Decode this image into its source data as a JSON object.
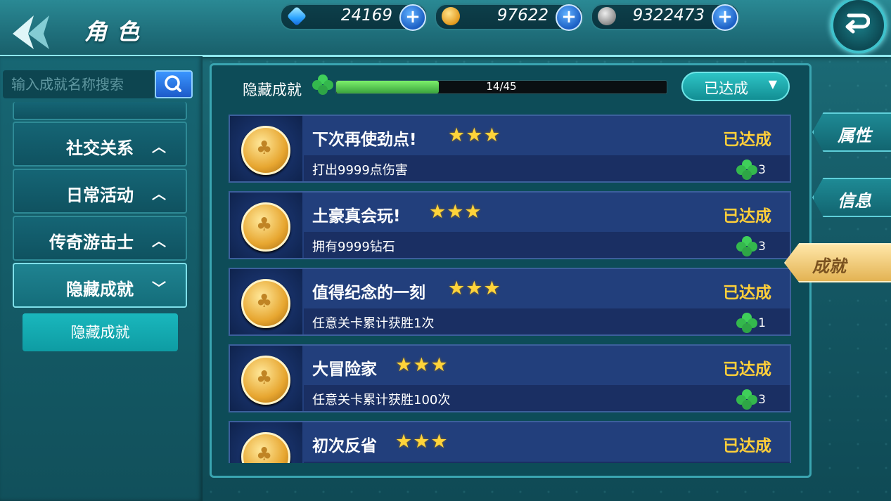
{
  "header": {
    "title": "角色"
  },
  "resources": [
    {
      "name": "gem",
      "value": "24169"
    },
    {
      "name": "gold",
      "value": "97622"
    },
    {
      "name": "silver",
      "value": "9322473"
    }
  ],
  "sidebar": {
    "search_placeholder": "输入成就名称搜索",
    "items": [
      {
        "label": "社交关系"
      },
      {
        "label": "日常活动"
      },
      {
        "label": "传奇游击士"
      },
      {
        "label": "隐藏成就"
      }
    ],
    "sub_button": "隐藏成就"
  },
  "panel": {
    "category_label": "隐藏成就",
    "progress_text": "14/45",
    "progress_fraction": 0.3111,
    "filter_label": "已达成"
  },
  "achievements": [
    {
      "name": "下次再使劲点!",
      "desc": "打出9999点伤害",
      "status": "已达成",
      "reward": "3",
      "stars": 3
    },
    {
      "name": "土豪真会玩!",
      "desc": "拥有9999钻石",
      "status": "已达成",
      "reward": "3",
      "stars": 3
    },
    {
      "name": "值得纪念的一刻",
      "desc": "任意关卡累计获胜1次",
      "status": "已达成",
      "reward": "1",
      "stars": 3
    },
    {
      "name": "大冒险家",
      "desc": "任意关卡累计获胜100次",
      "status": "已达成",
      "reward": "3",
      "stars": 3
    },
    {
      "name": "初次反省",
      "desc": "",
      "status": "已达成",
      "reward": "",
      "stars": 3
    }
  ],
  "right_tabs": [
    {
      "label": "属性"
    },
    {
      "label": "信息"
    },
    {
      "label": "成就"
    }
  ],
  "colors": {
    "accent": "#1ab7bd",
    "gold_text": "#ffcf3a",
    "progress": "#5dd055"
  }
}
